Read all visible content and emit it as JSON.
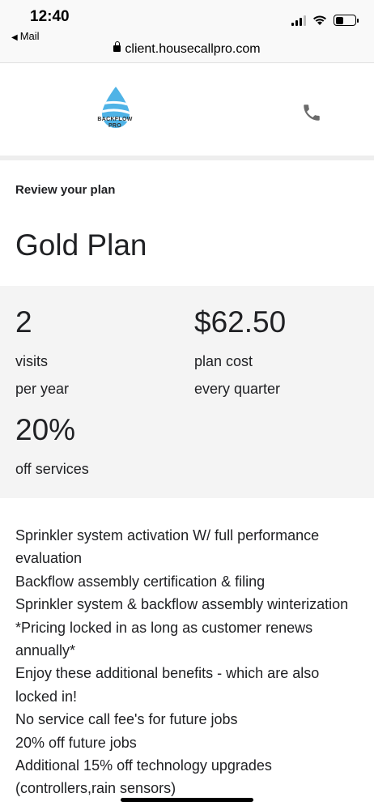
{
  "status": {
    "time": "12:40",
    "back_app": "Mail",
    "back_arrow": "◀"
  },
  "browser": {
    "url": "client.housecallpro.com"
  },
  "header": {
    "logo_line1": "BACKFLOW",
    "logo_line2": "PRO",
    "logo_icon": "water-drop-logo",
    "phone_icon": "phone-icon",
    "accent": "#4fb3e6"
  },
  "card": {
    "review_label": "Review your plan",
    "plan_name": "Gold Plan"
  },
  "stats": {
    "visits_value": "2",
    "visits_label": "visits",
    "visits_period": "per year",
    "cost_value": "$62.50",
    "cost_label": "plan cost",
    "cost_period": "every quarter",
    "discount_value": "20%",
    "discount_label": "off services"
  },
  "features": [
    "Sprinkler system activation W/ full performance evaluation",
    "Backflow assembly certification & filing",
    "Sprinkler system & backflow assembly winterization",
    "*Pricing locked in as long as customer renews annually*",
    "Enjoy these additional benefits - which are also locked in!",
    "No service call fee's for future jobs",
    "20% off future jobs",
    "Additional 15% off technology upgrades (controllers,rain sensors)"
  ]
}
